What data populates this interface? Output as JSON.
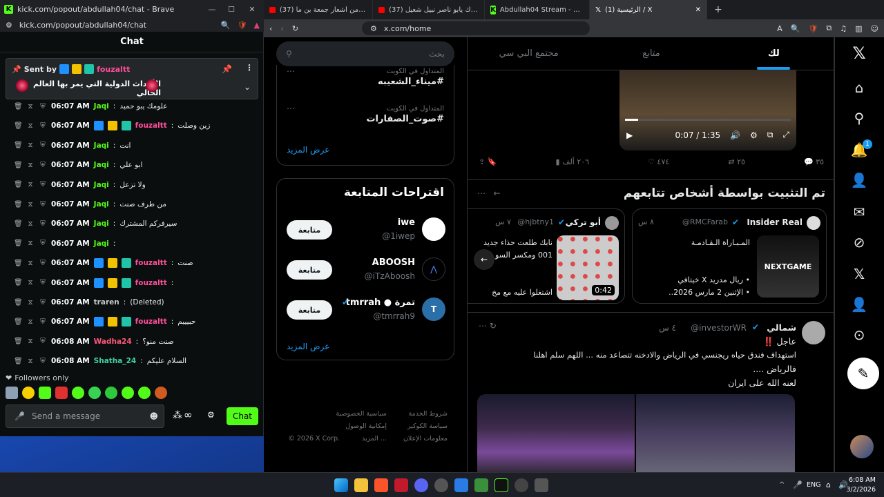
{
  "kick": {
    "title": "kick.com/popout/abdullah04/chat - Brave",
    "url": "kick.com/popout/abdullah04/chat",
    "header": "Chat",
    "pinned": {
      "sent_by_label": "Sent by",
      "sender": "fouzaltt",
      "text": "الأحداث الدولية التي يمر بها العالم الحالي"
    },
    "messages": [
      {
        "time": "06:07 AM",
        "user": "Jaqi",
        "color": "#53fc18",
        "text": "علومك يبو حميد",
        "badges": false
      },
      {
        "time": "06:07 AM",
        "user": "fouzaltt",
        "color": "#ff4f9a",
        "text": "زين وصلت",
        "badges": true
      },
      {
        "time": "06:07 AM",
        "user": "Jaqi",
        "color": "#53fc18",
        "text": "انت",
        "badges": false
      },
      {
        "time": "06:07 AM",
        "user": "Jaqi",
        "color": "#53fc18",
        "text": "ابو علي",
        "badges": false
      },
      {
        "time": "06:07 AM",
        "user": "Jaqi",
        "color": "#53fc18",
        "text": "ولا تزعل",
        "badges": false
      },
      {
        "time": "06:07 AM",
        "user": "Jaqi",
        "color": "#53fc18",
        "text": "من طرف صنت",
        "badges": false
      },
      {
        "time": "06:07 AM",
        "user": "Jaqi",
        "color": "#53fc18",
        "text": "سيرفركم المشترك",
        "badges": false
      },
      {
        "time": "06:07 AM",
        "user": "Jaqi",
        "color": "#53fc18",
        "text": "",
        "badges": false
      },
      {
        "time": "06:07 AM",
        "user": "fouzaltt",
        "color": "#ff4f9a",
        "text": "صنت",
        "badges": true
      },
      {
        "time": "06:07 AM",
        "user": "fouzaltt",
        "color": "#ff4f9a",
        "text": "",
        "badges": true
      },
      {
        "time": "06:07 AM",
        "user": "traren",
        "color": "#c9c9c9",
        "text": "(Deleted)",
        "badges": false
      },
      {
        "time": "06:07 AM",
        "user": "fouzaltt",
        "color": "#ff4f9a",
        "text": "حبيييم",
        "badges": true
      },
      {
        "time": "06:08 AM",
        "user": "Wadha24",
        "color": "#ff5a7a",
        "text": "صنت منو؟",
        "badges": false
      },
      {
        "time": "06:08 AM",
        "user": "Shatha_24",
        "color": "#3fd1a0",
        "text": "السلام عليكم",
        "badges": false
      }
    ],
    "followers_only": "Followers only",
    "send_placeholder": "Send a message",
    "chat_button": "Chat",
    "infinity": "∞",
    "accent": "#53fc18"
  },
  "browser": {
    "tabs": [
      {
        "label": "(37) خصيم الدار | من أشعار جمعة بن ما",
        "icon": "yt"
      },
      {
        "label": "(37) توعدك يابو ناصر نبيل شعيل - Tube",
        "icon": "yt"
      },
      {
        "label": "Abdullah04 Stream - Watch Live on Kick",
        "icon": "kick"
      },
      {
        "label": "(1) الرئيسية / X",
        "icon": "x"
      }
    ],
    "url": "x.com/home"
  },
  "x": {
    "tabs": [
      "لك",
      "متابع",
      "مجتمع البي سي"
    ],
    "video_time": "0:07 / 1:35",
    "actions": {
      "replies": "٣٥",
      "reposts": "٢٥",
      "likes": "٤٧٤",
      "views": "٢٠٦ ألف"
    },
    "pinned_title": "تم التثبيت بواسطة أشخاص تتابعهم",
    "card1": {
      "name": "Insider Real",
      "handle": "@RMCFarab",
      "age": "٨ س",
      "line1": "المـبـاراة الـقـادمـة",
      "line2": "• ريال مدريد X خيتافي",
      "line3": "• الإثنين 2 مارس 2026..",
      "thumb": "NEXTGAME"
    },
    "card2": {
      "name": "أبو تركي",
      "handle": "@hjbtny1",
      "age": "٧ س",
      "line1": "نابك طلعت حذاء جديد",
      "line2": "001 ومكسر السو",
      "line3": "اشتغلوا عليه مع مخ",
      "duration": "0:42"
    },
    "tweet": {
      "name": "شمالي",
      "handle": "@investorWR",
      "age": "٤ س",
      "l1": "عاجل ‼️",
      "l2": "استهداف فندق حياه ريجنسي في الرياض والادخنه تتصاعد منه ... اللهم سلم اهلنا",
      "l3": "فالرياض ....",
      "l4": "لعنه الله على ايران"
    },
    "search_placeholder": "بحث",
    "trends": [
      {
        "context": "المتداول في الكويت",
        "tag": "#ميناء_الشعيبه"
      },
      {
        "context": "المتداول في الكويت",
        "tag": "#صوت_الصفارات"
      }
    ],
    "show_more": "عرض المزيد",
    "follow_title": "اقتراحات المتابعة",
    "follow": [
      {
        "name": "iwe",
        "handle": "@1iwep",
        "btn": "متابعة"
      },
      {
        "name": "ABOOSH",
        "handle": "@iTzAboosh",
        "btn": "متابعة"
      },
      {
        "name": "tmrrah ● تمرة",
        "handle": "@tmrrah9",
        "btn": "متابعة"
      }
    ],
    "footer": [
      "شروط الخدمة",
      "سياسية الخصوصية",
      "سياسة الكوكيز",
      "إمكانية الوصول",
      "معلومات الإعلان",
      "المزيد ...",
      "© 2026 X Corp."
    ],
    "notif_count": "1",
    "accent": "#1d9bf0"
  },
  "taskbar": {
    "lang": "ENG",
    "time": "6:08 AM",
    "date": "3/2/2026"
  }
}
